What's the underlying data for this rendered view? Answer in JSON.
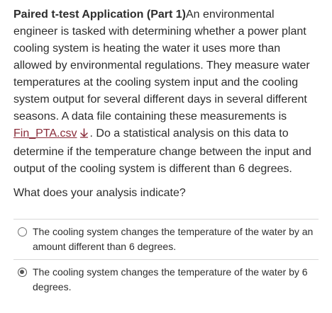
{
  "question": {
    "title": "Paired t-test Application (Part 1)",
    "body_before_link": "An environmental engineer is tasked with determining whether a power plant cooling system is heating the water it uses more than allowed by environmental regulations. They measure water temperatures at the cooling system input and the cooling system output for several different days in several different seasons. A data file containing these measurements is ",
    "file_link": "Fin_PTA.csv",
    "body_after_link": ". Do a statistical analysis on this data to determine if the temperature change between the input and output of the cooling system is different than 6 degrees.",
    "prompt": "What does your analysis indicate?"
  },
  "options": [
    {
      "label": "The cooling system changes the temperature of the water by an amount different than 6 degrees.",
      "selected": false
    },
    {
      "label": "The cooling system changes the temperature of the water by 6 degrees.",
      "selected": true
    }
  ],
  "colors": {
    "link": "#8a2d3a",
    "text": "#2d2d2d",
    "divider": "#d9d9d9"
  },
  "icons": {
    "download": "download-arrow-icon"
  }
}
